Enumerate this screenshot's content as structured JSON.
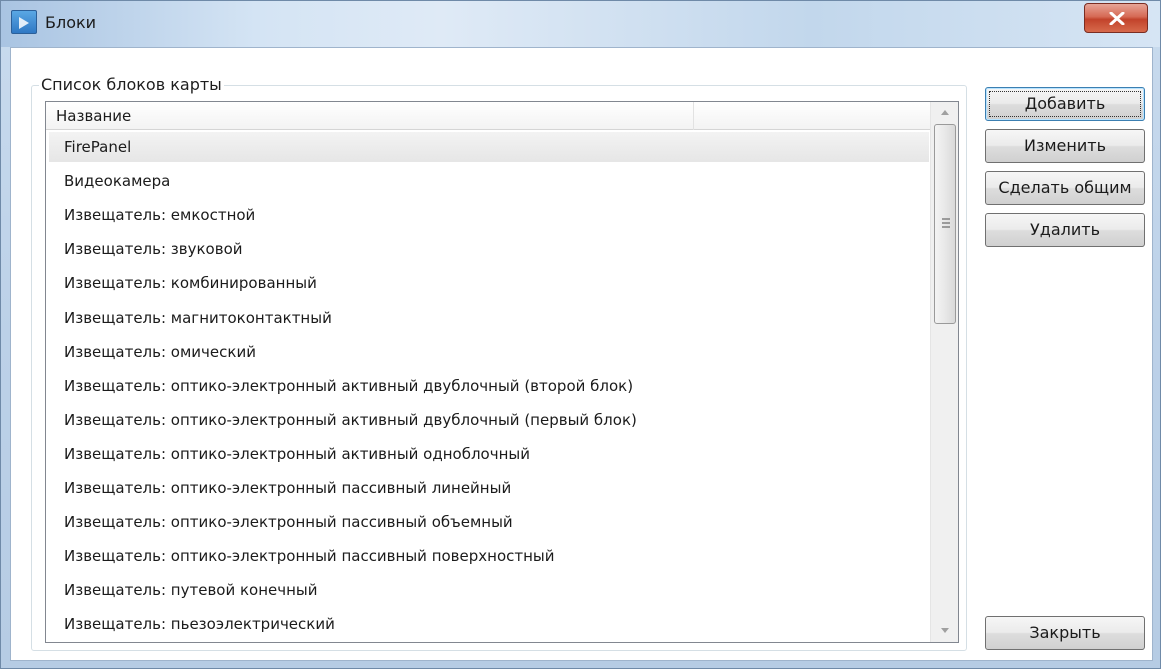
{
  "window": {
    "title": "Блоки",
    "close_icon": "close-x-icon"
  },
  "groupbox": {
    "label": "Список блоков карты"
  },
  "list": {
    "columns": [
      "Название",
      ""
    ],
    "selected_index": 0,
    "rows": [
      "FirePanel",
      "Видеокамера",
      "Извещатель: емкостной",
      "Извещатель: звуковой",
      "Извещатель: комбинированный",
      "Извещатель: магнитоконтактный",
      "Извещатель: омический",
      "Извещатель: оптико-электронный активный двублочный (второй блок)",
      "Извещатель: оптико-электронный активный двублочный (первый блок)",
      "Извещатель: оптико-электронный активный одноблочный",
      "Извещатель: оптико-электронный пассивный линейный",
      "Извещатель: оптико-электронный пассивный объемный",
      "Извещатель: оптико-электронный пассивный поверхностный",
      "Извещатель: путевой конечный",
      "Извещатель: пьезоэлектрический"
    ]
  },
  "buttons": {
    "add": "Добавить",
    "edit": "Изменить",
    "make_common": "Сделать общим",
    "delete": "Удалить",
    "close": "Закрыть"
  },
  "colors": {
    "selection": "#e9e9e9",
    "close_button": "#c9462d",
    "title_bar": "#cfe0f2"
  }
}
